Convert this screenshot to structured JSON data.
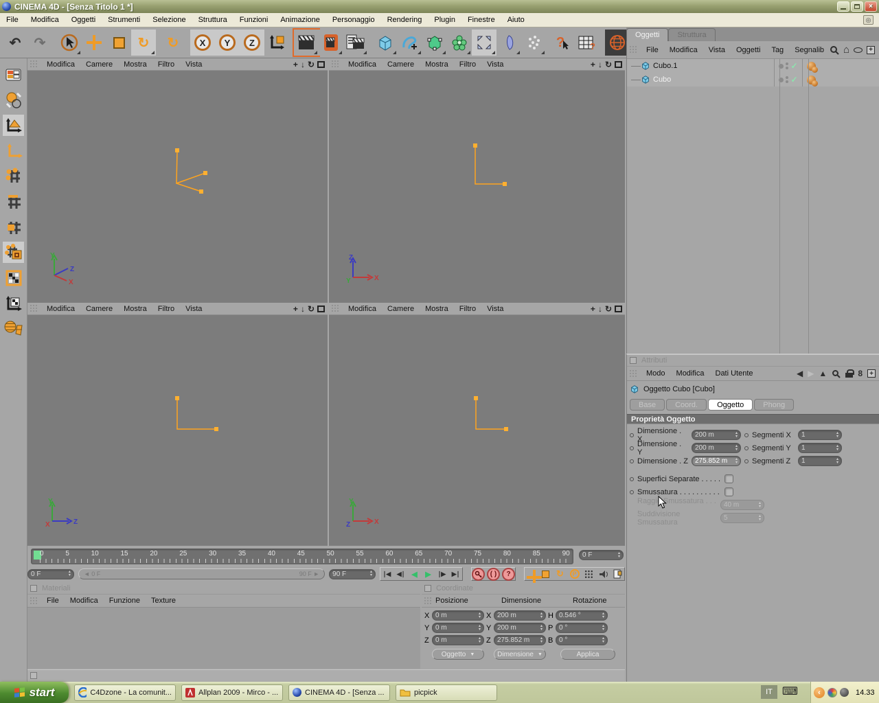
{
  "window": {
    "title": "CINEMA 4D - [Senza Titolo 1 *]"
  },
  "menu_bar": [
    "File",
    "Modifica",
    "Oggetti",
    "Strumenti",
    "Selezione",
    "Struttura",
    "Funzioni",
    "Animazione",
    "Personaggio",
    "Rendering",
    "Plugin",
    "Finestre",
    "Aiuto"
  ],
  "icons": {
    "undo": "↶",
    "redo": "↷",
    "rotate": "↻",
    "axis_x": "X",
    "axis_y": "Y",
    "axis_z": "Z",
    "question": "?",
    "param": "P",
    "pan": "+",
    "dolly": "↓",
    "back": "◀",
    "forward": "▶",
    "up": "▲",
    "home": "⌂",
    "history": "8",
    "check": "✓",
    "goto_start": "∣◀",
    "step_back": "◀∣",
    "play_back": "◀",
    "play": "▶",
    "step_fwd": "∣▶",
    "goto_end": "▶∣",
    "parens": "( )",
    "keyboard": "⌨",
    "collapse": "‹",
    "close": "×"
  },
  "colors": {
    "orange": "#ef9b26",
    "viewport_bg": "#7c7c7c",
    "ui_bg": "#a6a6a6",
    "wire_orange": "#ffa41e",
    "axis_x": "#c23a3a",
    "axis_y": "#3aa73a",
    "axis_z": "#3a3ac2",
    "playhead_green": "#72dd92"
  },
  "viewport": {
    "menu": [
      "Modifica",
      "Camere",
      "Mostra",
      "Filtro",
      "Vista"
    ],
    "axis": {
      "x": "X",
      "y": "Y",
      "z": "Z"
    }
  },
  "timeline": {
    "ticks": [
      "0",
      "5",
      "10",
      "15",
      "20",
      "25",
      "30",
      "35",
      "40",
      "45",
      "50",
      "55",
      "60",
      "65",
      "70",
      "75",
      "80",
      "85",
      "90"
    ],
    "current_frame": "0 F",
    "range_start": "0 F",
    "range_end": "90 F",
    "end_frame": "90 F"
  },
  "materials": {
    "title": "Materiali",
    "menu": [
      "File",
      "Modifica",
      "Funzione",
      "Texture"
    ]
  },
  "coordinates": {
    "title": "Coordinate",
    "col_position": "Posizione",
    "col_size": "Dimensione",
    "col_rotation": "Rotazione",
    "rows": [
      {
        "pl": "X",
        "pv": "0 m",
        "sl": "X",
        "sv": "200 m",
        "rl": "H",
        "rv": "0.546 °"
      },
      {
        "pl": "Y",
        "pv": "0 m",
        "sl": "Y",
        "sv": "200 m",
        "rl": "P",
        "rv": "0 °"
      },
      {
        "pl": "Z",
        "pv": "0 m",
        "sl": "Z",
        "sv": "275.852 m",
        "rl": "B",
        "rv": "0 °"
      }
    ],
    "mode_object": "Oggetto",
    "mode_size": "Dimensione",
    "apply": "Applica"
  },
  "object_manager": {
    "tabs": {
      "active": "Oggetti",
      "inactive": "Struttura"
    },
    "menu": [
      "File",
      "Modifica",
      "Vista",
      "Oggetti",
      "Tag",
      "Segnalib"
    ],
    "objects": [
      {
        "name": "Cubo.1"
      },
      {
        "name": "Cubo"
      }
    ]
  },
  "attributes": {
    "title": "Attributi",
    "menu": [
      "Modo",
      "Modifica",
      "Dati Utente"
    ],
    "object_header": "Oggetto Cubo [Cubo]",
    "tabs": [
      "Base",
      "Coord.",
      "Oggetto",
      "Phong"
    ],
    "active_tab": "Oggetto",
    "section": "Proprietà Oggetto",
    "rows": [
      {
        "label": "Dimensione . X",
        "value": "200 m",
        "label2": "Segmenti X",
        "value2": "1"
      },
      {
        "label": "Dimensione . Y",
        "value": "200 m",
        "label2": "Segmenti Y",
        "value2": "1"
      },
      {
        "label": "Dimensione . Z",
        "value": "275.852 m",
        "label2": "Segmenti Z",
        "value2": "1"
      }
    ],
    "check1": "Superfici Separate . . . . .",
    "check2": "Smussatura . . . . . . . . . .",
    "disabled1_label": "Raggio Smussatura . . . .",
    "disabled1_value": "40 m",
    "disabled2_label": "Suddivisione Smussatura",
    "disabled2_value": "5"
  },
  "taskbar": {
    "start": "start",
    "tasks": [
      {
        "title": "C4Dzone - La comunit..."
      },
      {
        "title": "Allplan 2009 - Mirco - ..."
      },
      {
        "title": "CINEMA 4D - [Senza ..."
      },
      {
        "title": "picpick"
      }
    ],
    "lang": "IT",
    "clock": "14.33"
  }
}
